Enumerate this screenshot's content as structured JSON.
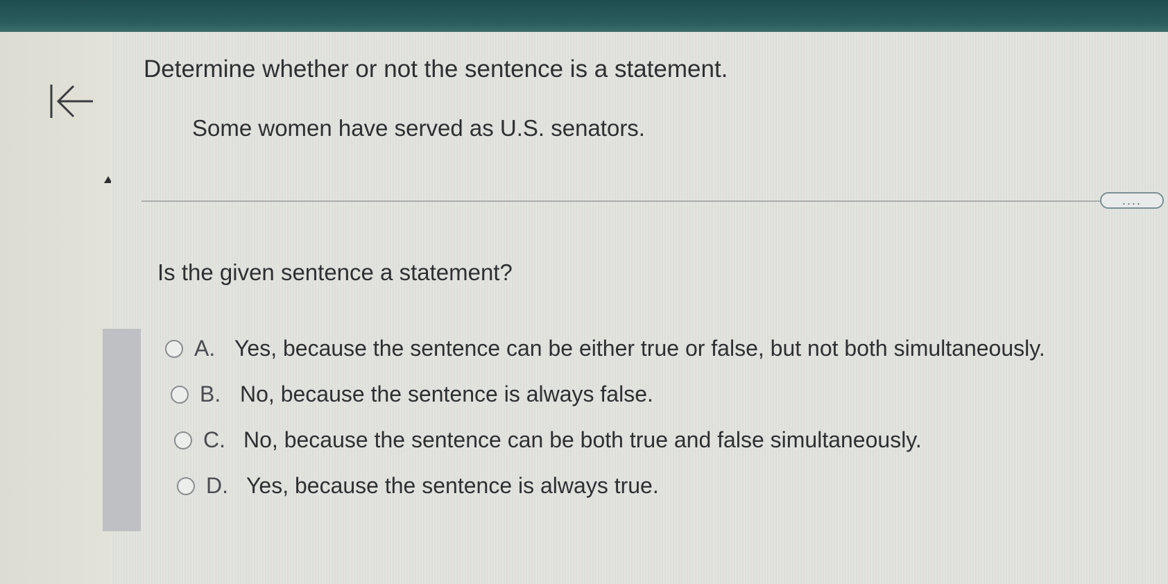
{
  "header": {
    "bar_color": "#245556"
  },
  "nav": {
    "back_icon": "arrow-left-to-bar-icon"
  },
  "problem": {
    "instruction": "Determine whether or not the sentence is a statement.",
    "sentence": "Some women have served as U.S. senators.",
    "more_button_label": "....",
    "question": "Is the given sentence a statement?"
  },
  "options": [
    {
      "letter": "A.",
      "text": "Yes, because the sentence can be either true or false, but not both simultaneously."
    },
    {
      "letter": "B.",
      "text": "No, because the sentence is always false."
    },
    {
      "letter": "C.",
      "text": "No, because the sentence can be both true and false simultaneously."
    },
    {
      "letter": "D.",
      "text": "Yes, because the sentence is always true."
    }
  ]
}
